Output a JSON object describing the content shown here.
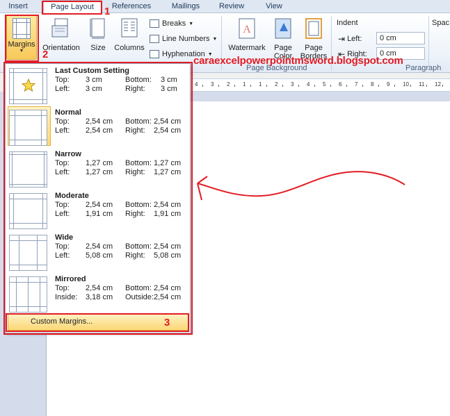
{
  "tabs": [
    {
      "label": "Insert"
    },
    {
      "label": "Page Layout"
    },
    {
      "label": "References"
    },
    {
      "label": "Mailings"
    },
    {
      "label": "Review"
    },
    {
      "label": "View"
    }
  ],
  "ribbon": {
    "margins_label": "Margins",
    "orientation_label": "Orientation",
    "size_label": "Size",
    "columns_label": "Columns",
    "breaks_label": "Breaks",
    "line_numbers_label": "Line Numbers",
    "hyphenation_label": "Hyphenation",
    "watermark_label": "Watermark",
    "page_color_label": "Page Color",
    "page_borders_label": "Page Borders",
    "page_background_group": "Page Background",
    "indent_group_title": "Indent",
    "left_label": "Left:",
    "left_value": "0 cm",
    "right_label": "Right:",
    "right_value": "0 cm",
    "paragraph_group": "Paragraph",
    "spacing_group_title": "Spac"
  },
  "margins_menu": {
    "options": [
      {
        "name": "Last Custom Setting",
        "k1": "Top:",
        "v1": "3 cm",
        "k2": "Bottom:",
        "v2": "3 cm",
        "k3": "Left:",
        "v3": "3 cm",
        "k4": "Right:",
        "v4": "3 cm"
      },
      {
        "name": "Normal",
        "k1": "Top:",
        "v1": "2,54 cm",
        "k2": "Bottom:",
        "v2": "2,54 cm",
        "k3": "Left:",
        "v3": "2,54 cm",
        "k4": "Right:",
        "v4": "2,54 cm"
      },
      {
        "name": "Narrow",
        "k1": "Top:",
        "v1": "1,27 cm",
        "k2": "Bottom:",
        "v2": "1,27 cm",
        "k3": "Left:",
        "v3": "1,27 cm",
        "k4": "Right:",
        "v4": "1,27 cm"
      },
      {
        "name": "Moderate",
        "k1": "Top:",
        "v1": "2,54 cm",
        "k2": "Bottom:",
        "v2": "2,54 cm",
        "k3": "Left:",
        "v3": "1,91 cm",
        "k4": "Right:",
        "v4": "1,91 cm"
      },
      {
        "name": "Wide",
        "k1": "Top:",
        "v1": "2,54 cm",
        "k2": "Bottom:",
        "v2": "2,54 cm",
        "k3": "Left:",
        "v3": "5,08 cm",
        "k4": "Right:",
        "v4": "5,08 cm"
      },
      {
        "name": "Mirrored",
        "k1": "Top:",
        "v1": "2,54 cm",
        "k2": "Bottom:",
        "v2": "2,54 cm",
        "k3": "Inside:",
        "v3": "3,18 cm",
        "k4": "Outside:",
        "v4": "2,54 cm"
      }
    ],
    "custom_margins_label": "Custom Margins..."
  },
  "ruler": {
    "numbers": [
      "4",
      "3",
      "2",
      "1",
      "1",
      "2",
      "3",
      "4",
      "5",
      "6",
      "7",
      "8",
      "9",
      "10",
      "11",
      "12"
    ]
  },
  "annotations": {
    "step1": "1",
    "step2": "2",
    "step3": "3",
    "watermark_text": "caraexcelpowerpointmsword.blogspot.com"
  },
  "colors": {
    "accent": "#e31b23",
    "selected_fill": "#fbd775",
    "ribbon_text": "#1e395b"
  }
}
